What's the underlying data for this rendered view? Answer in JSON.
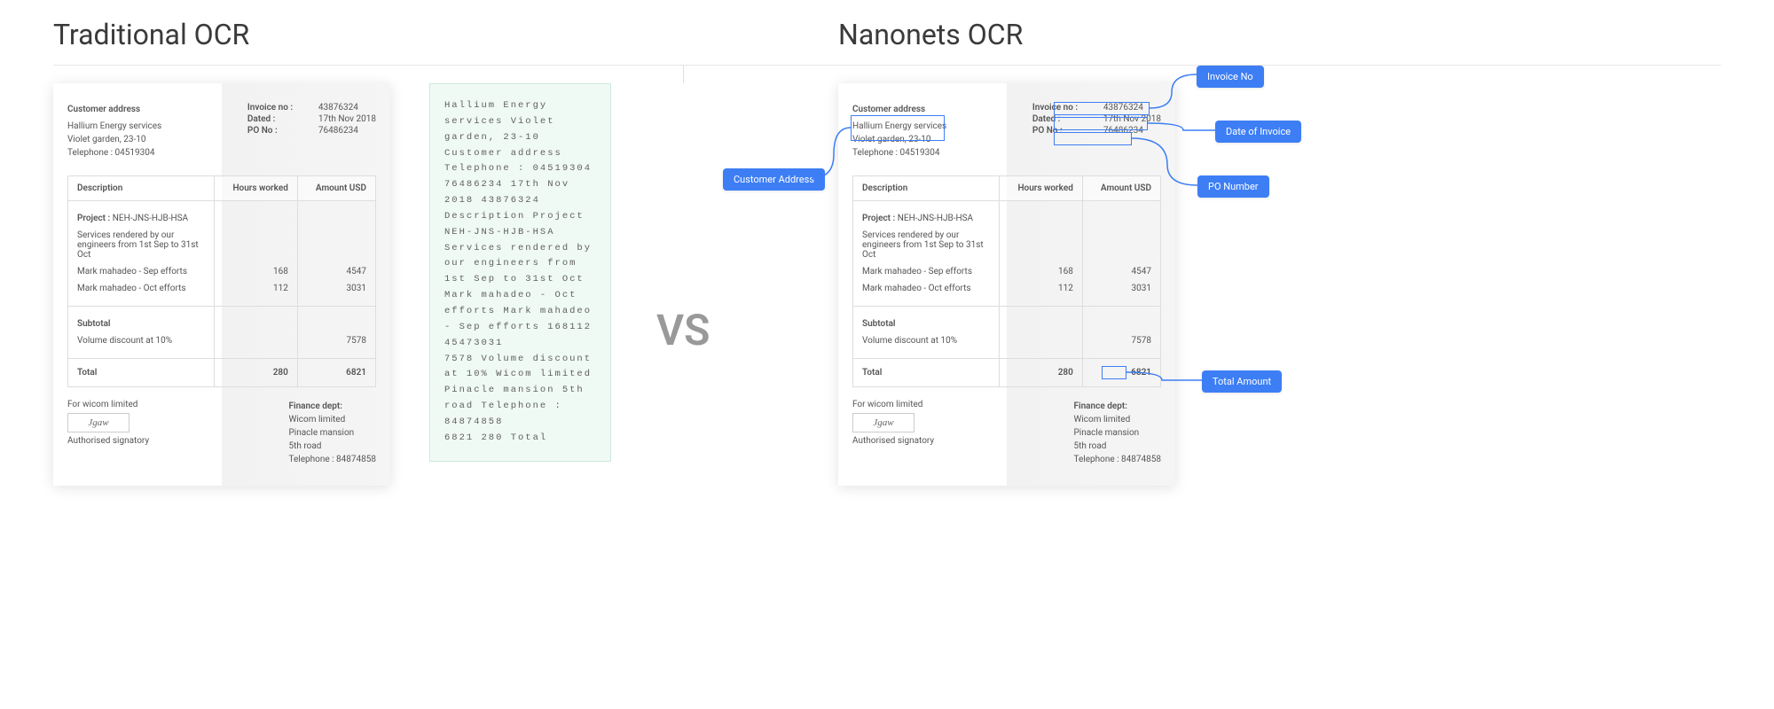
{
  "headers": {
    "traditional": "Traditional OCR",
    "nanonets": "Nanonets OCR"
  },
  "vs": "VS",
  "invoice": {
    "customer_address_label": "Customer address",
    "customer_lines": [
      "Hallium Energy services",
      "Violet garden, 23-10",
      "Telephone : 04519304"
    ],
    "meta": {
      "invoice_no_label": "Invoice no :",
      "invoice_no": "43876324",
      "dated_label": "Dated :",
      "dated": "17th Nov 2018",
      "po_label": "PO No :",
      "po": "76486234"
    },
    "columns": [
      "Description",
      "Hours worked",
      "Amount USD"
    ],
    "project_label": "Project :",
    "project_code": "NEH-JNS-HJB-HSA",
    "services_desc": "Services rendered by our engineers from 1st Sep to 31st Oct",
    "rows": [
      {
        "desc": "Mark mahadeo - Sep efforts",
        "hours": "168",
        "amount": "4547"
      },
      {
        "desc": "Mark mahadeo - Oct efforts",
        "hours": "112",
        "amount": "3031"
      }
    ],
    "subtotal_label": "Subtotal",
    "discount_label": "Volume discount at 10%",
    "discount_amount": "7578",
    "total_label": "Total",
    "total_hours": "280",
    "total_amount": "6821",
    "for_wicom": "For wicom limited",
    "auth_sig": "Authorised signatory",
    "finance_label": "Finance dept:",
    "finance_lines": [
      "Wicom limited",
      "Pinacle mansion",
      "5th road",
      "Telephone : 84874858"
    ]
  },
  "raw_ocr": "Hallium Energy services Violet garden, 23-10 Customer address Telephone : 04519304 76486234 17th Nov 2018 43876324\nDescription Project NEH-JNS-HJB-HSA Services rendered by our engineers from 1st Sep to 31st Oct\nMark mahadeo - Oct efforts Mark mahadeo - Sep efforts 168112 45473031\n7578 Volume discount at 10% Wicom limited Pinacle mansion 5th road Telephone : 84874858\n6821 280 Total",
  "annotations": {
    "customer_address": "Customer Address",
    "invoice_no": "Invoice No",
    "date_of_invoice": "Date of Invoice",
    "po_number": "PO Number",
    "total_amount": "Total Amount"
  }
}
